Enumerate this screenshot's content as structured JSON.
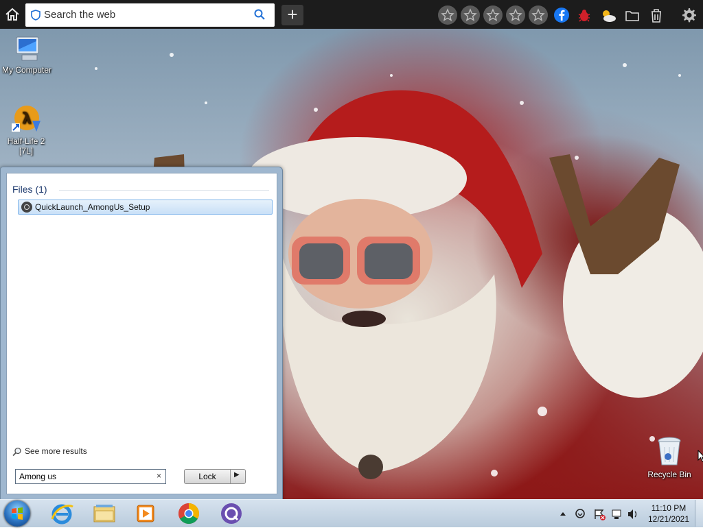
{
  "browser_bar": {
    "search_placeholder": "Search the web",
    "toolbar_icons": [
      "star-icon",
      "star-icon",
      "star-icon",
      "star-icon",
      "star-icon",
      "facebook-icon",
      "bug-icon",
      "weather-icon",
      "folder-icon",
      "trash-icon"
    ]
  },
  "desktop": {
    "icons": [
      {
        "label": "My Computer"
      },
      {
        "label": "Half-Life 2 [7L]"
      },
      {
        "label": "Recycle Bin"
      }
    ]
  },
  "start_menu": {
    "files_header": "Files (1)",
    "results": [
      {
        "label": "QuickLaunch_AmongUs_Setup"
      }
    ],
    "see_more": "See more results",
    "search_value": "Among us",
    "clear_glyph": "×",
    "lock_label": "Lock"
  },
  "taskbar": {
    "apps": [
      "start-orb",
      "internet-explorer-icon",
      "file-explorer-icon",
      "media-player-icon",
      "chrome-icon",
      "quicklaunch-icon"
    ],
    "clock": {
      "time": "11:10 PM",
      "date": "12/21/2021"
    }
  },
  "colors": {
    "topbar": "#1c1c1c",
    "facebook": "#1877f2",
    "taskbar": "#c9d8e6"
  }
}
